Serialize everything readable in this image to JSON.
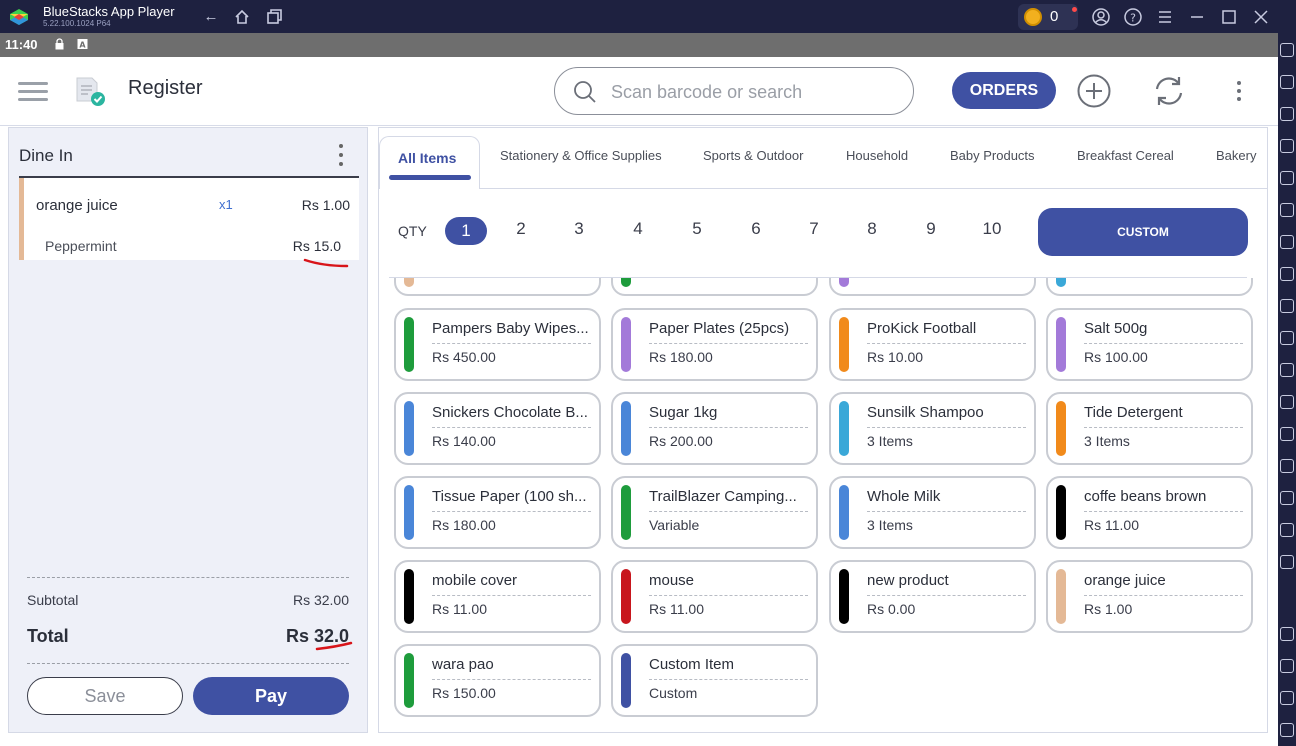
{
  "bluestacks": {
    "title": "BlueStacks App Player",
    "version": "5.22.100.1024  P64",
    "coins": "0"
  },
  "status_bar": {
    "time": "11:40"
  },
  "header": {
    "title": "Register",
    "search_placeholder": "Scan barcode or search",
    "orders_label": "ORDERS"
  },
  "cart": {
    "title": "Dine In",
    "line": {
      "name": "orange juice",
      "qty": "x1",
      "price": "Rs 1.00"
    },
    "modifier": {
      "name": "Peppermint",
      "price": "Rs 15.0"
    },
    "subtotal_label": "Subtotal",
    "subtotal_value": "Rs 32.00",
    "total_label": "Total",
    "total_value": "Rs 32.0",
    "save_label": "Save",
    "pay_label": "Pay"
  },
  "catalog": {
    "tabs": [
      "All Items",
      "Stationery & Office Supplies",
      "Sports & Outdoor",
      "Household",
      "Baby Products",
      "Breakfast Cereal",
      "Bakery"
    ],
    "qty_label": "QTY",
    "qty_options": [
      "1",
      "2",
      "3",
      "4",
      "5",
      "6",
      "7",
      "8",
      "9",
      "10"
    ],
    "custom_label": "CUSTOM",
    "products": [
      {
        "name": "Pampers Baby Wipes...",
        "sub": "Rs 450.00",
        "color": "#1e9c3c"
      },
      {
        "name": "Paper Plates (25pcs)",
        "sub": "Rs 180.00",
        "color": "#a37ad9"
      },
      {
        "name": "ProKick Football",
        "sub": "Rs 10.00",
        "color": "#f18a1b"
      },
      {
        "name": "Salt 500g",
        "sub": "Rs 100.00",
        "color": "#a37ad9"
      },
      {
        "name": "Snickers Chocolate B...",
        "sub": "Rs 140.00",
        "color": "#4a86d8"
      },
      {
        "name": "Sugar 1kg",
        "sub": "Rs 200.00",
        "color": "#4a86d8"
      },
      {
        "name": "Sunsilk Shampoo",
        "sub": "3 Items",
        "color": "#3aa8d8"
      },
      {
        "name": "Tide Detergent",
        "sub": "3 Items",
        "color": "#f18a1b"
      },
      {
        "name": "Tissue Paper (100 sh...",
        "sub": "Rs 180.00",
        "color": "#4a86d8"
      },
      {
        "name": "TrailBlazer Camping...",
        "sub": "Variable",
        "color": "#1e9c3c"
      },
      {
        "name": "Whole Milk",
        "sub": "3 Items",
        "color": "#4a86d8"
      },
      {
        "name": "coffe beans brown",
        "sub": "Rs 11.00",
        "color": "#000000"
      },
      {
        "name": "mobile cover",
        "sub": "Rs 11.00",
        "color": "#000000"
      },
      {
        "name": "mouse",
        "sub": "Rs 11.00",
        "color": "#c8161d"
      },
      {
        "name": "new product",
        "sub": "Rs 0.00",
        "color": "#000000"
      },
      {
        "name": "orange juice",
        "sub": "Rs 1.00",
        "color": "#e4b996"
      },
      {
        "name": "wara pao",
        "sub": "Rs 150.00",
        "color": "#1e9c3c"
      },
      {
        "name": "Custom Item",
        "sub": "Custom",
        "color": "#3f51a3"
      }
    ],
    "partial_row_colors": [
      "#e4b996",
      "#1e9c3c",
      "#a37ad9",
      "#3aa8d8"
    ]
  },
  "colors": {
    "primary": "#3f51a3",
    "annotation": "#d8141a"
  }
}
